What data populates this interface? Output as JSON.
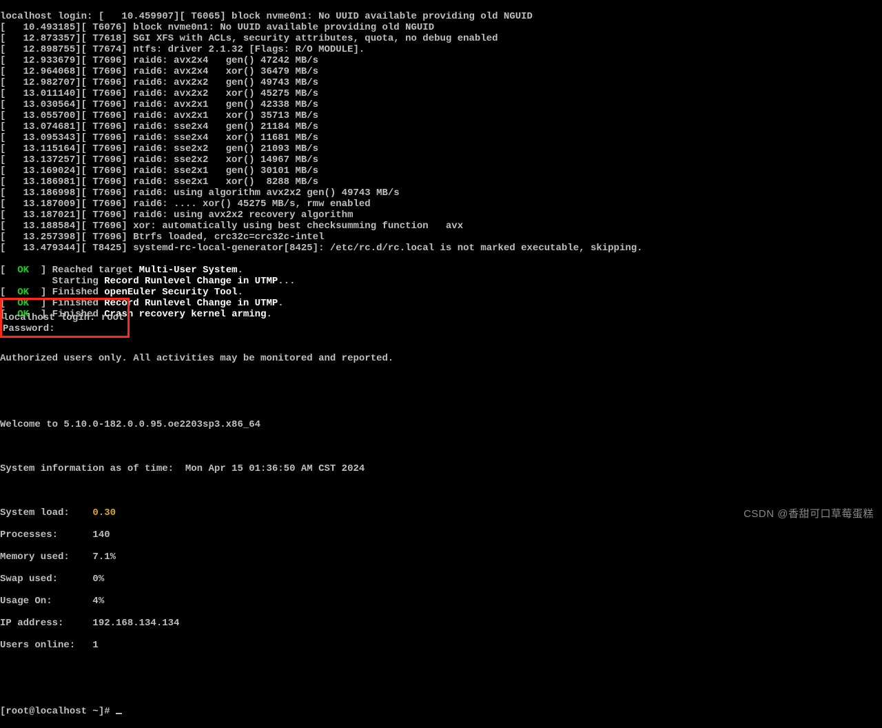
{
  "boot": [
    "localhost login: [   10.459907][ T6065] block nvme0n1: No UUID available providing old NGUID",
    "[   10.493185][ T6076] block nvme0n1: No UUID available providing old NGUID",
    "[   12.873357][ T7618] SGI XFS with ACLs, security attributes, quota, no debug enabled",
    "[   12.898755][ T7674] ntfs: driver 2.1.32 [Flags: R/O MODULE].",
    "[   12.933679][ T7696] raid6: avx2x4   gen() 47242 MB/s",
    "[   12.964068][ T7696] raid6: avx2x4   xor() 36479 MB/s",
    "[   12.982707][ T7696] raid6: avx2x2   gen() 49743 MB/s",
    "[   13.011140][ T7696] raid6: avx2x2   xor() 45275 MB/s",
    "[   13.030564][ T7696] raid6: avx2x1   gen() 42338 MB/s",
    "[   13.055700][ T7696] raid6: avx2x1   xor() 35713 MB/s",
    "[   13.074681][ T7696] raid6: sse2x4   gen() 21184 MB/s",
    "[   13.095343][ T7696] raid6: sse2x4   xor() 11681 MB/s",
    "[   13.115164][ T7696] raid6: sse2x2   gen() 21093 MB/s",
    "[   13.137257][ T7696] raid6: sse2x2   xor() 14967 MB/s",
    "[   13.169024][ T7696] raid6: sse2x1   gen() 30101 MB/s",
    "[   13.186981][ T7696] raid6: sse2x1   xor()  8288 MB/s",
    "[   13.186998][ T7696] raid6: using algorithm avx2x2 gen() 49743 MB/s",
    "[   13.187009][ T7696] raid6: .... xor() 45275 MB/s, rmw enabled",
    "[   13.187021][ T7696] raid6: using avx2x2 recovery algorithm",
    "[   13.188584][ T7696] xor: automatically using best checksumming function   avx",
    "[   13.257398][ T7696] Btrfs loaded, crc32c=crc32c-intel",
    "[   13.479344][ T8425] systemd-rc-local-generator[8425]: /etc/rc.d/rc.local is not marked executable, skipping."
  ],
  "status": [
    {
      "b1": "[  ",
      "ok": "OK",
      "b2": "  ] Reached target ",
      "msg": "Multi-User System",
      "dot": "."
    },
    {
      "plain": "         Starting ",
      "msg": "Record Runlevel Change in UTMP",
      "dot": "..."
    },
    {
      "b1": "[  ",
      "ok": "OK",
      "b2": "  ] Finished ",
      "msg": "openEuler Security Tool",
      "dot": "."
    },
    {
      "b1": "[  ",
      "ok": "OK",
      "b2": "  ] Finished ",
      "msg": "Record Runlevel Change in UTMP",
      "dot": "."
    },
    {
      "b1": "[  ",
      "ok": "OK",
      "b2": "  ] Finished ",
      "msg": "Crash recovery kernel arming",
      "dot": "."
    }
  ],
  "login": {
    "prompt": "localhost login: ",
    "user": "root",
    "password_label": "Password:"
  },
  "auth_notice": "Authorized users only. All activities may be monitored and reported.",
  "welcome": "Welcome to 5.10.0-182.0.0.95.oe2203sp3.x86_64",
  "sysinfo_time": "System information as of time:  Mon Apr 15 01:36:50 AM CST 2024",
  "stats": {
    "load_label": "System load:    ",
    "load_value": "0.30",
    "processes": "Processes:      140",
    "memory": "Memory used:    7.1%",
    "swap": "Swap used:      0%",
    "usage": "Usage On:       4%",
    "ip": "IP address:     192.168.134.134",
    "users": "Users online:   1"
  },
  "shell_prompt": "[root@localhost ~]# ",
  "watermark": "CSDN @香甜可口草莓蛋糕"
}
